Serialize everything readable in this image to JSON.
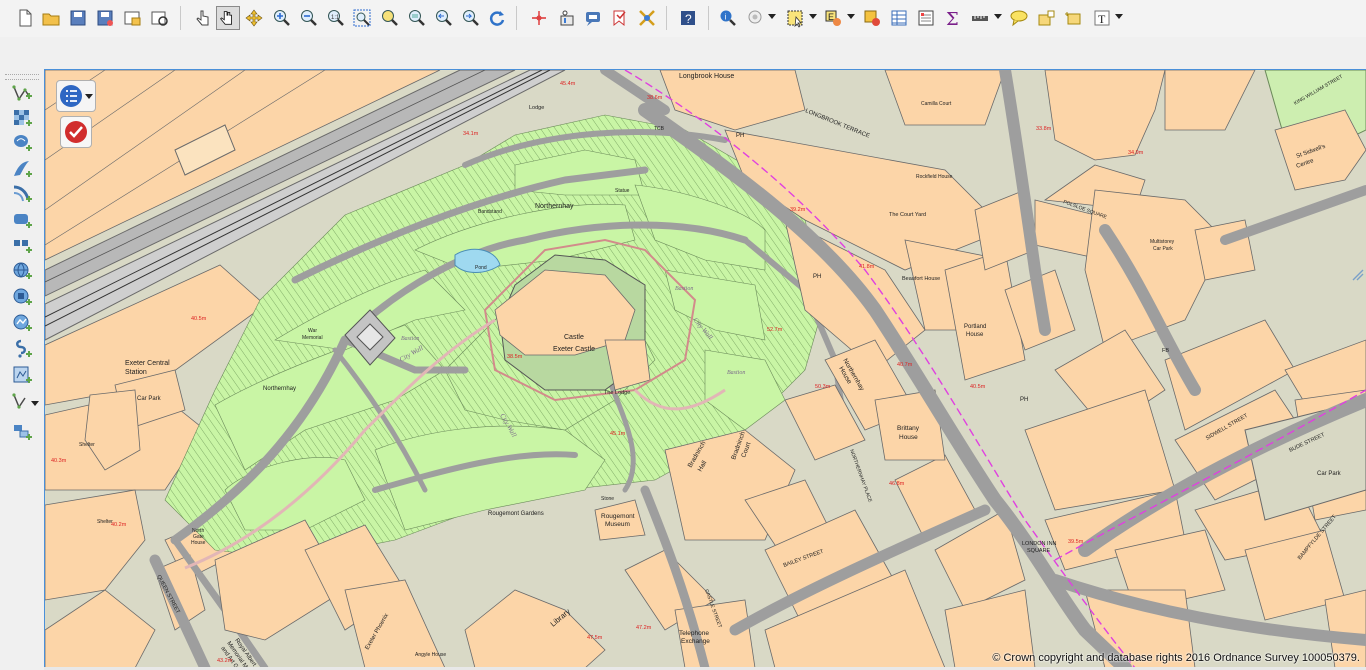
{
  "toolbar": {
    "buttons": [
      "new-project-icon",
      "open-project-icon",
      "save-project-icon",
      "save-as-icon",
      "new-print-layout-icon",
      "layout-manager-icon",
      "touch-zoom-icon",
      "pan-icon",
      "pan-to-selection-icon",
      "zoom-in-icon",
      "zoom-out-icon",
      "zoom-native-icon",
      "zoom-full-icon",
      "zoom-to-selection-icon",
      "zoom-to-layer-icon",
      "zoom-last-icon",
      "zoom-next-icon",
      "refresh-icon",
      "decoration-grid-icon",
      "temporal-icon",
      "map-tips-icon",
      "new-bookmark-icon",
      "show-bookmarks-icon",
      "help-icon",
      "identify-icon",
      "select-icon",
      "select-by-location-icon",
      "deselect-icon",
      "attribute-table-icon",
      "field-calculator-icon",
      "statistics-icon",
      "measure-icon",
      "annotation-icon",
      "text-annotation-icon",
      "label-icon"
    ]
  },
  "search": {
    "placeholder": "",
    "value": ""
  },
  "left_toolbar": {
    "buttons": [
      "add-vector-layer-icon",
      "add-raster-layer-icon",
      "add-postgis-layer-icon",
      "add-spatialite-layer-icon",
      "add-mssql-layer-icon",
      "add-db2-layer-icon",
      "add-oracle-layer-icon",
      "add-wms-layer-icon",
      "add-wcs-layer-icon",
      "add-wfs-layer-icon",
      "add-delimited-text-icon",
      "new-shapefile-icon",
      "add-virtual-layer-icon"
    ]
  },
  "map": {
    "copyright": "© Crown copyright and database rights 2016 Ordnance Survey 100050379.",
    "labels": {
      "longbrook_house": "Longbrook House",
      "longbrook_terrace": "LONGBROOK TERRACE",
      "lodge": "Lodge",
      "northernhay_top": "Northernhay",
      "bandstand": "Bandstand",
      "statue": "Statue",
      "pond": "Pond",
      "castle": "Castle",
      "exeter_castle": "Exeter Castle",
      "the_lodge": "The Lodge",
      "war_memorial_1": "War",
      "war_memorial_2": "Memorial",
      "northernhay_bottom": "Northernhay",
      "exeter_central_1": "Exeter Central",
      "exeter_central_2": "Station",
      "car_park": "Car Park",
      "rougemont_gardens": "Rougemont Gardens",
      "rougemont_museum_1": "Rougemont",
      "rougemont_museum_2": "Museum",
      "stone": "Stone",
      "library": "Library",
      "telephone_exchange_1": "Telephone",
      "telephone_exchange_2": "Exchange",
      "queen_street": "QUEEN STREET",
      "bailey_street": "BAILEY STREET",
      "london_inn_square_1": "LONDON INN",
      "london_inn_square_2": "SQUARE",
      "northernhay_house_1": "Northernhay",
      "northernhay_house_2": "House",
      "brittany_house_1": "Brittany",
      "brittany_house_2": "House",
      "portland_house_1": "Portland",
      "portland_house_2": "House",
      "beaufort_house": "Beaufort House",
      "court_yard": "The Court Yard",
      "multistorey_1": "Multistorey",
      "multistorey_2": "Car Park",
      "st_sidwells_1": "St Sidwell's",
      "st_sidwells_2": "Centre",
      "sidwell_street": "SIDWELL STREET",
      "bude_street": "BUDE STREET",
      "bampfylde_street": "BAMPFYLDE STREET",
      "king_william_street": "KING WILLIAM STREET",
      "paris_street": "PARIS STREET",
      "car_park_right": "Car Park",
      "city_wall_1": "City Wall",
      "city_wall_2": "City Wall",
      "city_wall_3": "City Wall",
      "bastion_1": "Bastion",
      "bastion_2": "Bastion",
      "bastion_3": "Bastion",
      "ph": "PH",
      "tcb": "TCB",
      "fb": "FB",
      "shelter": "Shelter",
      "north_gate_1": "North",
      "north_gate_2": "Gate",
      "north_gate_3": "House",
      "exeter_phoenix": "Exeter Phoenix",
      "ramm_1": "Royal Albert",
      "ramm_2": "Memorial Museum",
      "ramm_3": "and Art Gallery",
      "angyle_house": "Angyle House",
      "bradninch_hall_1": "Bradninch",
      "bradninch_hall_2": "Hall",
      "bradninch_court_1": "Bradninch",
      "bradninch_court_2": "Court",
      "polsloe_square": "POLSLOE SQUARE",
      "rockfield_house": "Rockfield House",
      "camilla_court": "Camilla Court",
      "castle_street": "CASTLE STREET",
      "northernhay_place": "NORTHERNHAY PLACE"
    },
    "spot_heights": [
      "45.4m",
      "38.6m",
      "34.1m",
      "40.5m",
      "38.5m",
      "39.2m",
      "41.8m",
      "50.3m",
      "46.8m",
      "40.5m",
      "40.2m",
      "40.3m",
      "47.5m",
      "47.2m",
      "43.2m",
      "33.8m",
      "34.9m",
      "52.7m",
      "39.5m",
      "45.1m",
      "40.7m"
    ]
  }
}
